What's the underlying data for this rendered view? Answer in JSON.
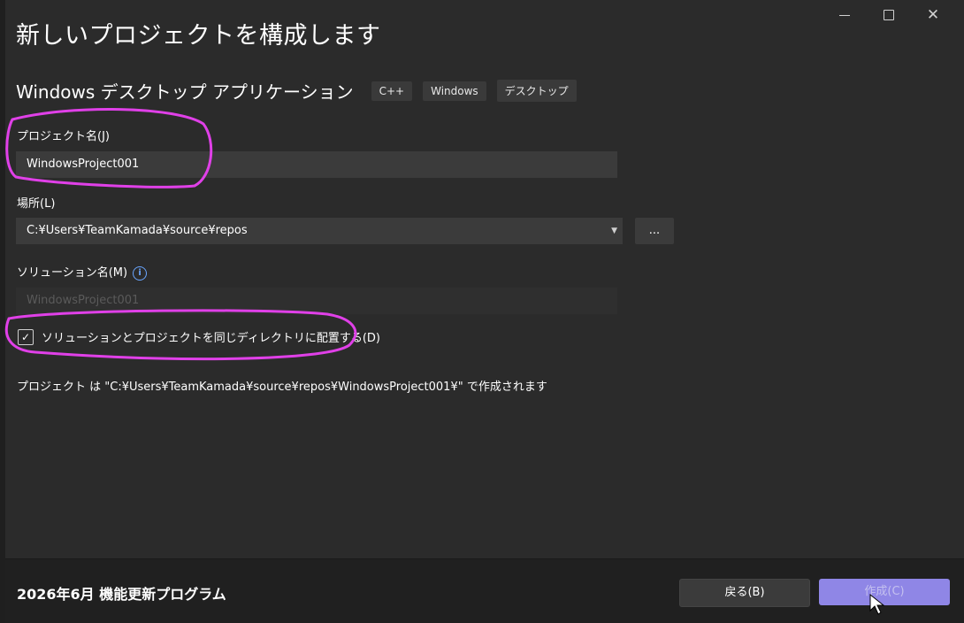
{
  "dialog": {
    "title": "新しいプロジェクトを構成します",
    "template_name": "Windows デスクトップ アプリケーション",
    "tags": [
      "C++",
      "Windows",
      "デスクトップ"
    ]
  },
  "window_controls": {
    "minimize_icon": "minimize-icon",
    "maximize_icon": "maximize-icon",
    "close_icon": "close-icon"
  },
  "form": {
    "project_name_label": "プロジェクト名(J)",
    "project_name_value": "WindowsProject001",
    "location_label": "場所(L)",
    "location_value": "C:¥Users¥TeamKamada¥source¥repos",
    "browse_label": "...",
    "solution_name_label": "ソリューション名(M)",
    "solution_name_value": "WindowsProject001",
    "same_dir_label": "ソリューションとプロジェクトを同じディレクトリに配置する(D)",
    "same_dir_checked": true,
    "path_info": "プロジェクト は \"C:¥Users¥TeamKamada¥source¥repos¥WindowsProject001¥\" で作成されます"
  },
  "footer": {
    "update_text": "2026年6月 機能更新プログラム",
    "back_label": "戻る(B)",
    "create_label": "作成(C)"
  },
  "colors": {
    "accent": "#8f86e6",
    "annotation": "#e040e8",
    "background": "#2b2b2b"
  }
}
